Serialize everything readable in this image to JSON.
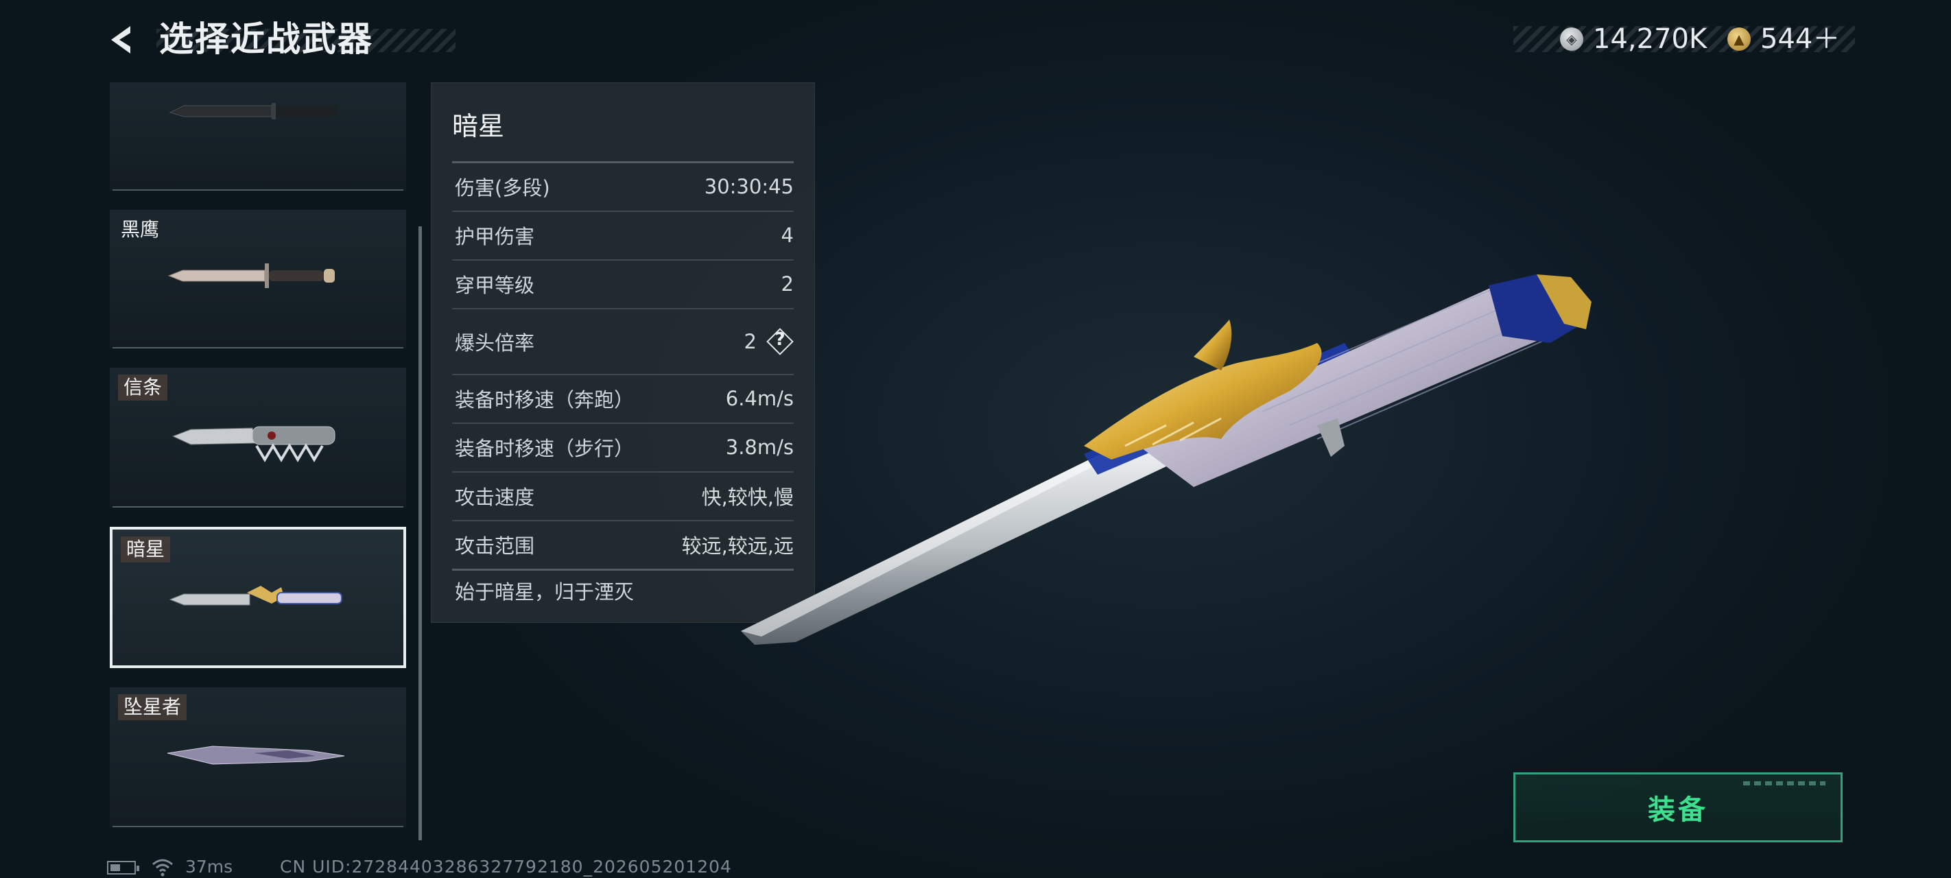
{
  "header": {
    "title": "选择近战武器",
    "currency": [
      {
        "icon": "silver-coin-icon",
        "value": "14,270K"
      },
      {
        "icon": "gold-coin-icon",
        "value": "544＋"
      }
    ]
  },
  "weapon_list": {
    "items": [
      {
        "name": "",
        "selected": false
      },
      {
        "name": "黑鹰",
        "selected": false
      },
      {
        "name": "信条",
        "selected": false
      },
      {
        "name": "暗星",
        "selected": true
      },
      {
        "name": "坠星者",
        "selected": false
      }
    ]
  },
  "stats": {
    "weapon_name": "暗星",
    "rows": [
      {
        "label": "伤害(多段)",
        "value": "30:30:45"
      },
      {
        "label": "护甲伤害",
        "value": "4"
      },
      {
        "label": "穿甲等级",
        "value": "2"
      },
      {
        "label": "爆头倍率",
        "value": "2",
        "help": "?"
      },
      {
        "label": "装备时移速（奔跑）",
        "value": "6.4m/s"
      },
      {
        "label": "装备时移速（步行）",
        "value": "3.8m/s"
      },
      {
        "label": "攻击速度",
        "value": "快,较快,慢"
      },
      {
        "label": "攻击范围",
        "value": "较远,较远,远"
      }
    ],
    "description": "始于暗星，归于湮灭"
  },
  "equip_button": {
    "label": "装备"
  },
  "status_bar": {
    "ping": "37ms",
    "uid": "CN UID:27284403286327792180_202605201204"
  },
  "colors": {
    "accent_green": "#3ee08f",
    "panel_bg": "#242c32",
    "background": "#13202a"
  }
}
